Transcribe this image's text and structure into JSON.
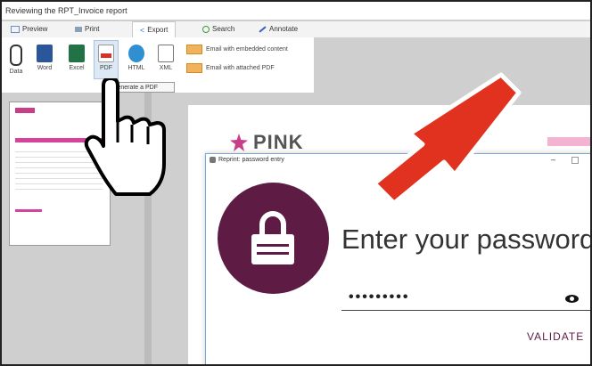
{
  "window": {
    "title": "Reviewing the RPT_Invoice report"
  },
  "tabs": [
    {
      "label": "Preview"
    },
    {
      "label": "Print"
    },
    {
      "label": "Export"
    },
    {
      "label": "Search"
    },
    {
      "label": "Annotate"
    }
  ],
  "ribbon": {
    "buttons": [
      {
        "label": "Data"
      },
      {
        "label": "Word"
      },
      {
        "label": "Excel"
      },
      {
        "label": "PDF"
      },
      {
        "label": "HTML"
      },
      {
        "label": "XML"
      }
    ],
    "email_embedded": "Email with embedded content",
    "email_attached": "Email with attached PDF",
    "tooltip": "Generate a PDF"
  },
  "document": {
    "brand": "PINK"
  },
  "dialog": {
    "title": "Reprint: password entry",
    "min_glyph": "–",
    "heading": "Enter your password",
    "password_mask": "•••••••••",
    "validate": "VALIDATE"
  },
  "colors": {
    "accent": "#5e1b44",
    "arrow": "#e0321e",
    "brand_pink": "#c83e88"
  }
}
